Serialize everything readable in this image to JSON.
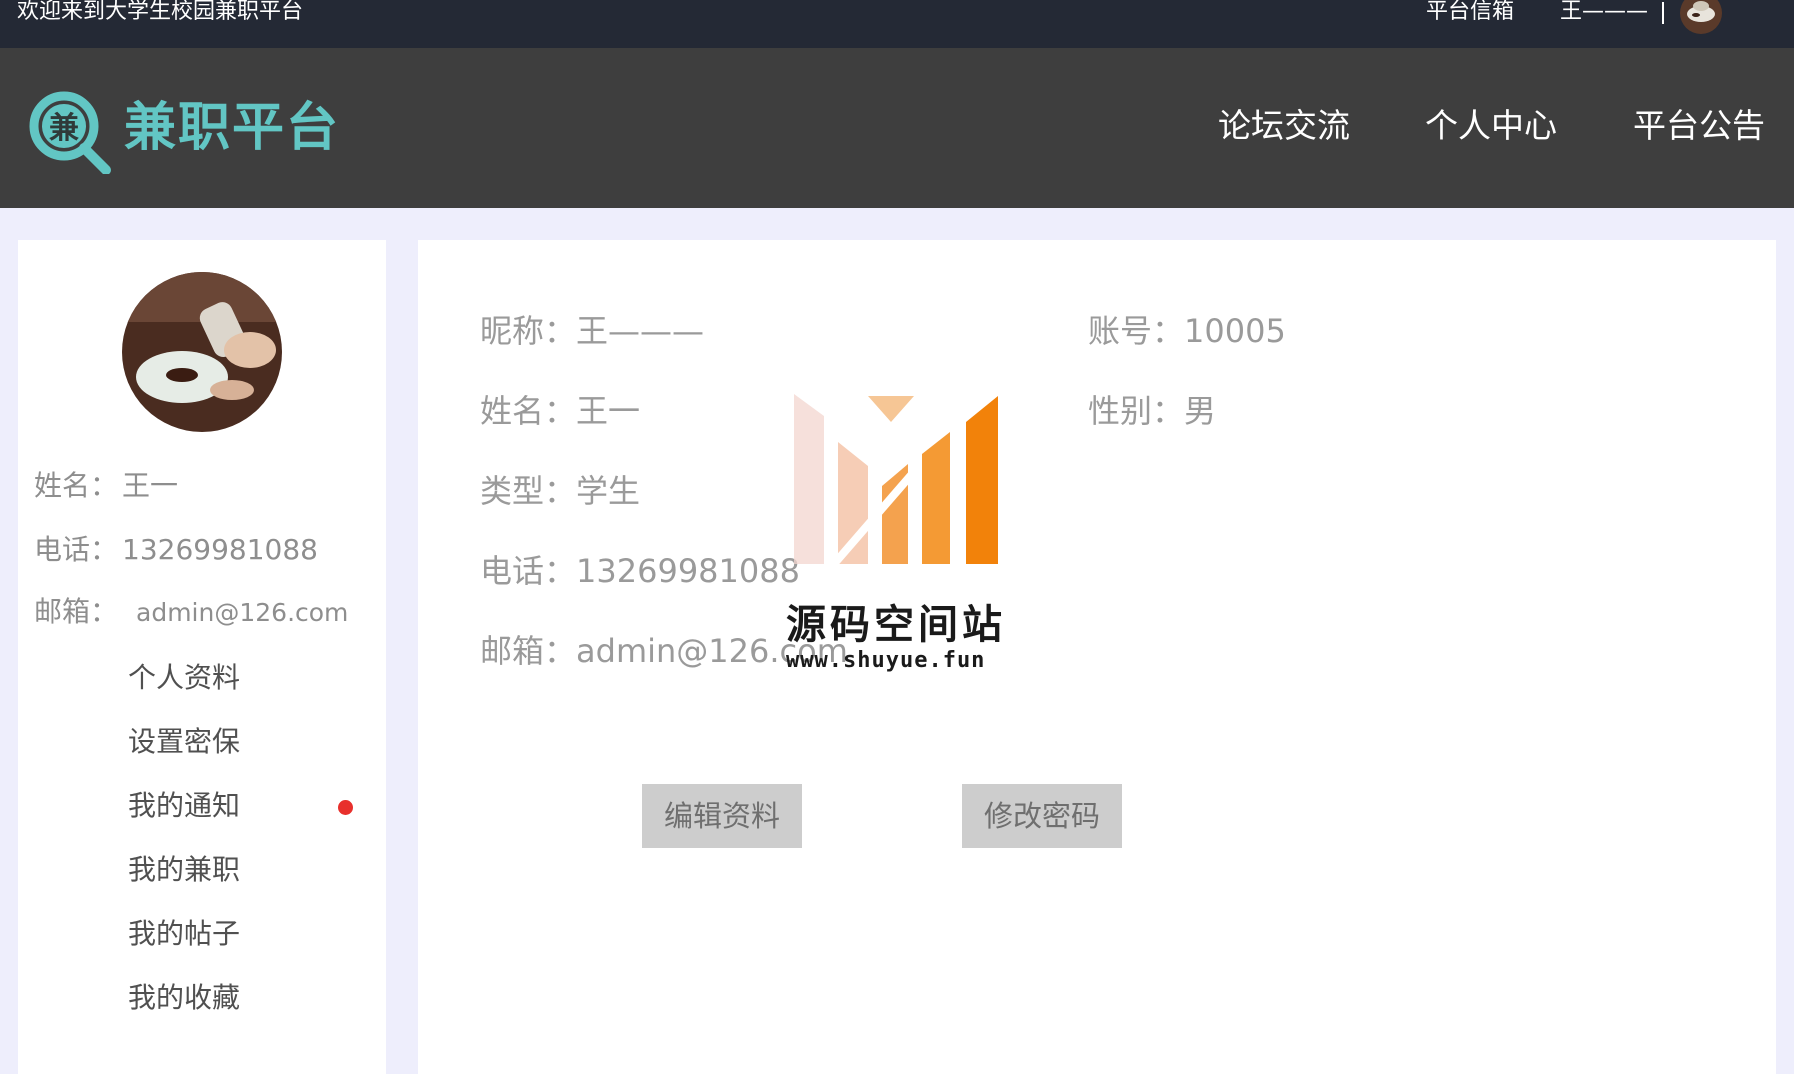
{
  "topbar": {
    "welcome": "欢迎来到大学生校园兼职平台",
    "mailbox": "平台信箱",
    "username": "王———"
  },
  "header": {
    "logo_char": "兼",
    "brand": "兼职平台",
    "nav": [
      "论坛交流",
      "个人中心",
      "平台公告"
    ]
  },
  "sidebar": {
    "info": {
      "name_label": "姓名：",
      "name": "王一",
      "phone_label": "电话：",
      "phone": "13269981088",
      "email_label": "邮箱：",
      "email": "admin@126.com"
    },
    "menu": [
      "个人资料",
      "设置密保",
      "我的通知",
      "我的兼职",
      "我的帖子",
      "我的收藏"
    ],
    "notice_dot_color": "#e8302c"
  },
  "profile": {
    "nickname_label": "昵称：",
    "nickname": "王———",
    "account_label": "账号：",
    "account": "10005",
    "name_label": "姓名：",
    "name": "王一",
    "gender_label": "性别：",
    "gender": "男",
    "type_label": "类型：",
    "type": "学生",
    "phone_label": "电话：",
    "phone": "13269981088",
    "email_label": "邮箱：",
    "email": "admin@126.com"
  },
  "actions": {
    "edit_profile": "编辑资料",
    "change_password": "修改密码"
  },
  "watermark": {
    "title": "源码空间站",
    "url": "www.shuyue.fun"
  },
  "colors": {
    "topbar": "#242935",
    "header": "#3e3e3e",
    "brand": "#62c6c4",
    "page_bg": "#eeeefc",
    "button_bg": "#cdcdcd"
  }
}
